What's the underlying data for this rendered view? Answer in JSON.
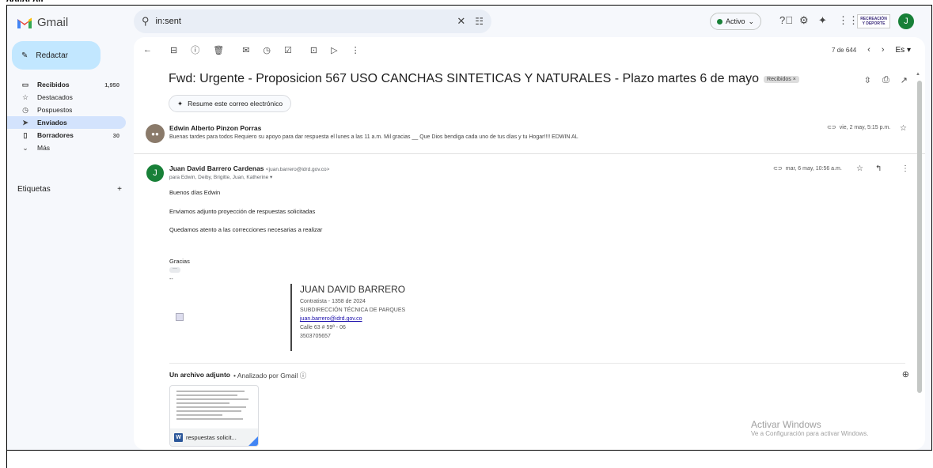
{
  "header": {
    "app_name": "Gmail",
    "search_value": "in:sent",
    "status_label": "Activo",
    "org_logo_text": "RECREACIÓN Y DEPORTE",
    "avatar_letter": "J"
  },
  "sidebar": {
    "compose_label": "Redactar",
    "items": [
      {
        "label": "Recibidos",
        "count": "1,950",
        "icon": "inbox-icon"
      },
      {
        "label": "Destacados",
        "count": "",
        "icon": "star-icon"
      },
      {
        "label": "Pospuestos",
        "count": "",
        "icon": "clock-icon"
      },
      {
        "label": "Enviados",
        "count": "",
        "icon": "send-icon"
      },
      {
        "label": "Borradores",
        "count": "30",
        "icon": "draft-icon"
      },
      {
        "label": "Más",
        "count": "",
        "icon": "chevron-down-icon"
      }
    ],
    "labels_title": "Etiquetas",
    "labels_add": "+"
  },
  "toolbar": {
    "pager_text": "7 de 644",
    "lang": "Es"
  },
  "thread": {
    "subject": "Fwd: Urgente - Proposicion 567 USO CANCHAS SINTETICAS Y NATURALES - Plazo martes 6 de mayo",
    "label_tag": "Recibidos ×",
    "summarize_label": "Resume este correo electrónico",
    "message1": {
      "sender": "Edwin Alberto Pinzon Porras",
      "snippet": "Buenas tardes para todos Requiero su apoyo para dar respuesta el lunes a las 11 a.m. Mil gracias __ Que Dios bendiga cada uno de tus días y tu Hogar!!!! EDWIN AL",
      "date": "vie, 2 may, 5:15 p.m."
    },
    "message2": {
      "sender": "Juan David Barrero Cardenas",
      "sender_email": "<juan.barrero@idrd.gov.co>",
      "to": "para Edwin, Deiby, Brigitte, Juan, Katherine ▾",
      "date": "mar, 6 may, 10:56 a.m.",
      "avatar_letter": "J",
      "body": [
        "Buenos días Edwin",
        "Enviamos adjunto proyección de respuestas solicitadas",
        "Quedamos atento a  las correcciones necesarias a realizar",
        "Gracias"
      ],
      "dash": "--",
      "signature": {
        "name": "JUAN DAVID BARRERO",
        "line1": "Contratista - 1358 de 2024",
        "line2": "SUBDIRECCIÓN TÉCNICA DE PARQUES",
        "email": "juan.barrero@idrd.gov.co",
        "address": "Calle 63 # 59ª - 06",
        "phone": "3503705657"
      }
    },
    "attachments": {
      "title": "Un archivo adjunto",
      "analyzed": "• Analizado por Gmail ⓘ",
      "file_name": "respuestas solicit..."
    }
  },
  "watermark": {
    "line1": "Activar Windows",
    "line2": "Ve a Configuración para activar Windows."
  }
}
